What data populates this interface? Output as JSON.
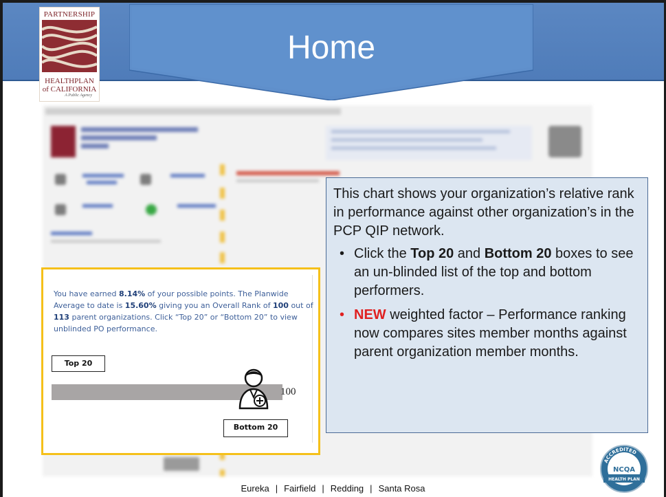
{
  "header": {
    "title": "Home",
    "band_color": "#5b87c2"
  },
  "logo": {
    "line1": "PARTNERSHIP",
    "line2": "HEALTHPLAN",
    "line3": "of CALIFORNIA",
    "tagline": "A Public Agency"
  },
  "callout": {
    "intro": "This chart shows your organization’s relative rank in performance against other organization’s in the PCP QIP network.",
    "bullets": [
      {
        "pre": "Click the ",
        "bold1": "Top 20",
        "mid": " and ",
        "bold2": "Bottom 20",
        "post": " boxes to see an un-blinded list of the top and bottom performers."
      },
      {
        "new_label": "NEW",
        "text": " weighted factor – Performance ranking now compares sites member months against parent organization member months."
      }
    ],
    "bullet_glyph": "•"
  },
  "rank_panel": {
    "msg_a": "You have earned ",
    "earned_pct": "8.14%",
    "msg_b": " of your possible points. The Planwide Average to date is ",
    "avg_pct": "15.60%",
    "msg_c": " giving you an Overall Rank of ",
    "rank": "100",
    "msg_d": " out of ",
    "total": "113",
    "msg_e": " parent organizations. Click “Top 20” or “Bottom 20” to view unblinded PO performance.",
    "top_button": "Top 20",
    "bottom_button": "Bottom 20",
    "rank_label": "100",
    "border_color": "#f5c01a"
  },
  "footer": {
    "cities": [
      "Eureka",
      "Fairfield",
      "Redding",
      "Santa Rosa"
    ],
    "separator": "|"
  },
  "badge": {
    "top_text": "ACCREDITED",
    "name": "NCQA",
    "bottom_text": "HEALTH PLAN"
  }
}
